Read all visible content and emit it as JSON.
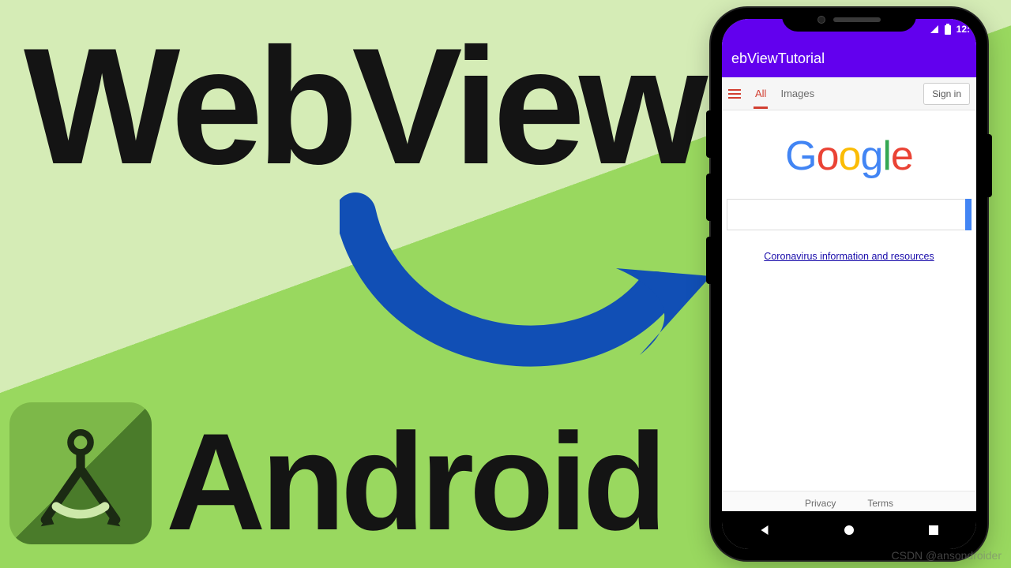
{
  "headline": {
    "line1": "WebView",
    "line2": "Android"
  },
  "icons": {
    "android_studio": "android-studio-icon",
    "arrow": "arrow-icon"
  },
  "phone": {
    "status": {
      "clock": "12:"
    },
    "appbar_title": "ebViewTutorial",
    "google": {
      "tabs": {
        "all": "All",
        "images": "Images"
      },
      "signin": "Sign in",
      "logo_letters": [
        "G",
        "o",
        "o",
        "g",
        "l",
        "e"
      ],
      "info_link": "Coronavirus information and resources",
      "footer": {
        "privacy": "Privacy",
        "terms": "Terms"
      }
    }
  },
  "watermark": "CSDN @ansondroider"
}
